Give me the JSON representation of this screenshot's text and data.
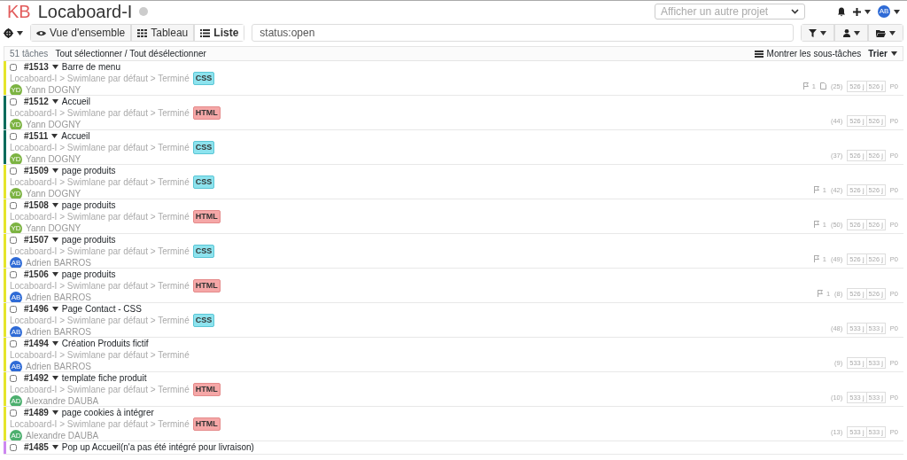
{
  "header": {
    "logo": "KB",
    "title": "Locaboard-I",
    "project_select_placeholder": "Afficher un autre projet",
    "user_initials": "AB"
  },
  "toolbar": {
    "views": [
      {
        "label": "Vue d'ensemble",
        "selected": false
      },
      {
        "label": "Tableau",
        "selected": false
      },
      {
        "label": "Liste",
        "selected": true
      }
    ],
    "search_value": "status:open"
  },
  "list_header": {
    "count": "51 tâches",
    "select_all": "Tout sélectionner / Tout désélectionner",
    "show_subtasks": "Montrer les sous-tâches",
    "sort": "Trier"
  },
  "tasks": [
    {
      "id": "#1513",
      "checked": false,
      "title": "Barre de menu",
      "path": "Locaboard-I > Swimlane par défaut > Terminé",
      "tag": "CSS",
      "assignee": {
        "initials": "YD",
        "name": "Yann DOGNY",
        "color": "#7cb342"
      },
      "color": "#e5e52b",
      "subtasks": "1",
      "attachment": true,
      "count": "(25)",
      "age1": "526 j",
      "age2": "526 j",
      "priority": "P0"
    },
    {
      "id": "#1512",
      "checked": false,
      "title": "Accueil",
      "path": "Locaboard-I > Swimlane par défaut > Terminé",
      "tag": "HTML",
      "assignee": {
        "initials": "YD",
        "name": "Yann DOGNY",
        "color": "#7cb342"
      },
      "color": "#006b5b",
      "count": "(44)",
      "age1": "526 j",
      "age2": "526 j",
      "priority": "P0"
    },
    {
      "id": "#1511",
      "checked": false,
      "title": "Accueil",
      "path": "Locaboard-I > Swimlane par défaut > Terminé",
      "tag": "CSS",
      "assignee": {
        "initials": "YD",
        "name": "Yann DOGNY",
        "color": "#7cb342"
      },
      "color": "#006b5b",
      "count": "(37)",
      "age1": "526 j",
      "age2": "526 j",
      "priority": "P0"
    },
    {
      "id": "#1509",
      "checked": false,
      "title": "page produits",
      "path": "Locaboard-I > Swimlane par défaut > Terminé",
      "tag": "CSS",
      "assignee": {
        "initials": "YD",
        "name": "Yann DOGNY",
        "color": "#7cb342"
      },
      "color": "#e5e52b",
      "subtasks": "1",
      "count": "(42)",
      "age1": "526 j",
      "age2": "526 j",
      "priority": "P0"
    },
    {
      "id": "#1508",
      "checked": false,
      "title": "page produits",
      "path": "Locaboard-I > Swimlane par défaut > Terminé",
      "tag": "HTML",
      "assignee": {
        "initials": "YD",
        "name": "Yann DOGNY",
        "color": "#7cb342"
      },
      "color": "#e5e52b",
      "subtasks": "1",
      "count": "(50)",
      "age1": "526 j",
      "age2": "526 j",
      "priority": "P0"
    },
    {
      "id": "#1507",
      "checked": false,
      "title": "page produits",
      "path": "Locaboard-I > Swimlane par défaut > Terminé",
      "tag": "CSS",
      "assignee": {
        "initials": "AB",
        "name": "Adrien BARROS",
        "color": "#2f6bd6"
      },
      "color": "#e5e52b",
      "subtasks": "1",
      "count": "(49)",
      "age1": "526 j",
      "age2": "526 j",
      "priority": "P0"
    },
    {
      "id": "#1506",
      "checked": false,
      "title": "page produits",
      "path": "Locaboard-I > Swimlane par défaut > Terminé",
      "tag": "HTML",
      "assignee": {
        "initials": "AB",
        "name": "Adrien BARROS",
        "color": "#2f6bd6"
      },
      "color": "#e5e52b",
      "subtasks": "1",
      "count": "(8)",
      "age1": "526 j",
      "age2": "526 j",
      "priority": "P0"
    },
    {
      "id": "#1496",
      "checked": false,
      "title": "Page Contact - CSS",
      "path": "Locaboard-I > Swimlane par défaut > Terminé",
      "tag": "CSS",
      "assignee": {
        "initials": "AB",
        "name": "Adrien BARROS",
        "color": "#2f6bd6"
      },
      "color": "#e5e52b",
      "count": "(48)",
      "age1": "533 j",
      "age2": "533 j",
      "priority": "P0"
    },
    {
      "id": "#1494",
      "checked": false,
      "title": "Création Produits fictif",
      "path": "Locaboard-I > Swimlane par défaut > Terminé",
      "assignee": {
        "initials": "AB",
        "name": "Adrien BARROS",
        "color": "#2f6bd6"
      },
      "color": "#e5e52b",
      "count": "(9)",
      "age1": "533 j",
      "age2": "533 j",
      "priority": "P0"
    },
    {
      "id": "#1492",
      "checked": false,
      "title": "template fiche produit",
      "path": "Locaboard-I > Swimlane par défaut > Terminé",
      "tag": "HTML",
      "assignee": {
        "initials": "AD",
        "name": "Alexandre DAUBA",
        "color": "#4caf6e"
      },
      "color": "#e5e52b",
      "count": "(10)",
      "age1": "533 j",
      "age2": "533 j",
      "priority": "P0"
    },
    {
      "id": "#1489",
      "checked": false,
      "title": "page cookies à intégrer",
      "path": "Locaboard-I > Swimlane par défaut > Terminé",
      "tag": "HTML",
      "assignee": {
        "initials": "AD",
        "name": "Alexandre DAUBA",
        "color": "#4caf6e"
      },
      "color": "#e5e52b",
      "count": "(13)",
      "age1": "533 j",
      "age2": "533 j",
      "priority": "P0"
    },
    {
      "id": "#1485",
      "checked": false,
      "title": "Pop up Accueil(n'a pas été intégré pour livraison)",
      "color": "#cc88f0"
    }
  ]
}
